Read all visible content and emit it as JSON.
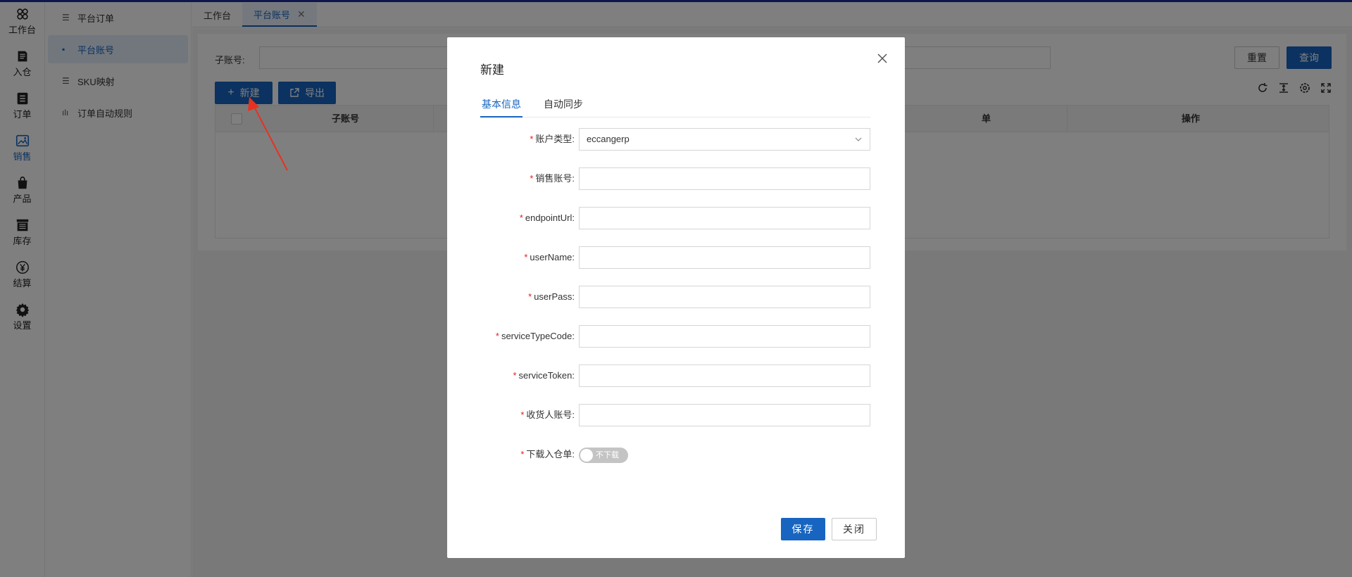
{
  "rail": {
    "items": [
      {
        "label": "工作台",
        "icon": "clover-icon"
      },
      {
        "label": "入仓",
        "icon": "book-icon"
      },
      {
        "label": "订单",
        "icon": "list-icon"
      },
      {
        "label": "销售",
        "icon": "image-icon"
      },
      {
        "label": "产品",
        "icon": "bag-icon"
      },
      {
        "label": "库存",
        "icon": "warehouse-icon"
      },
      {
        "label": "结算",
        "icon": "yuan-icon"
      },
      {
        "label": "设置",
        "icon": "gear-icon"
      }
    ]
  },
  "submenu": {
    "items": [
      {
        "label": "平台订单"
      },
      {
        "label": "平台账号"
      },
      {
        "label": "SKU映射"
      },
      {
        "label": "订单自动规则"
      }
    ]
  },
  "tabs": {
    "items": [
      {
        "label": "工作台"
      },
      {
        "label": "平台账号",
        "close": "✕"
      }
    ]
  },
  "filter": {
    "label": "子账号:",
    "reset": "重置",
    "search": "查询"
  },
  "toolbar": {
    "new": "新建",
    "export": "导出"
  },
  "table": {
    "columns": [
      "子账号",
      "单",
      "操作"
    ]
  },
  "dialog": {
    "title": "新建",
    "tabs": [
      "基本信息",
      "自动同步"
    ],
    "fields": [
      {
        "label": "账户类型:",
        "value": "eccangerp"
      },
      {
        "label": "销售账号:",
        "value": ""
      },
      {
        "label": "endpointUrl:",
        "value": ""
      },
      {
        "label": "userName:",
        "value": ""
      },
      {
        "label": "userPass:",
        "value": ""
      },
      {
        "label": "serviceTypeCode:",
        "value": ""
      },
      {
        "label": "serviceToken:",
        "value": ""
      },
      {
        "label": "收货人账号:",
        "value": ""
      },
      {
        "label": "下载入仓单:",
        "switch_text": "不下载"
      }
    ],
    "required_mark": "*",
    "save": "保存",
    "cancel": "关闭"
  },
  "colors": {
    "accent": "#1765c0",
    "required": "#e02020",
    "arrow": "#e8321f"
  }
}
